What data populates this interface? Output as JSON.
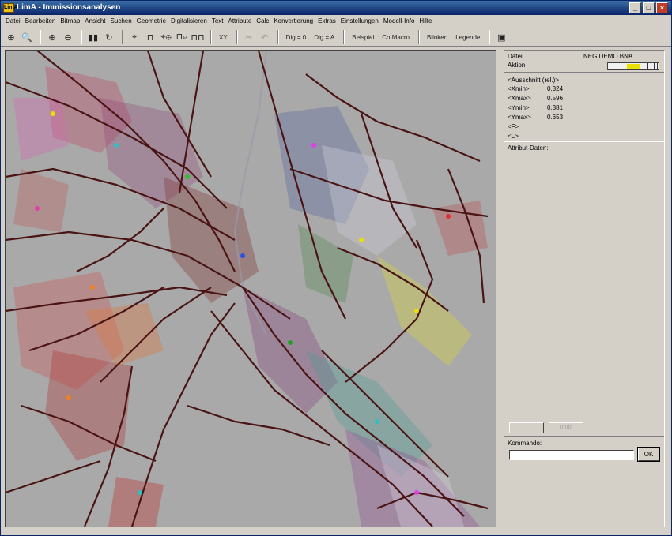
{
  "window": {
    "title": "LimA - Immissionsanalysen",
    "app_icon": "LimA",
    "buttons": [
      "_",
      "□",
      "×"
    ]
  },
  "menu": [
    "Datei",
    "Bearbeiten",
    "Bitmap",
    "Ansicht",
    "Suchen",
    "Geometrie",
    "Digitalisieren",
    "Text",
    "Attribute",
    "Calc",
    "Konvertierung",
    "Extras",
    "Einstellungen",
    "Modell-Info",
    "Hilfe"
  ],
  "toolbar": {
    "zoom_in_icon": "magnifier-icon",
    "dig0": "Dig = 0",
    "digA": "Dig = A",
    "beispiel": "Beispiel",
    "comacro": "Co Macro",
    "blinken": "Blinken",
    "legende": "Legende",
    "xy": "XY"
  },
  "panel": {
    "datei_label": "Datei",
    "datei_value": "NEG  DEMO.BNA",
    "aktion_label": "Aktion",
    "ausschnitt_label": "<Ausschnitt (rel.)>",
    "coords": [
      {
        "label": "<Xmin>",
        "value": "0.324"
      },
      {
        "label": "<Xmax>",
        "value": "0.596"
      },
      {
        "label": "<Ymin>",
        "value": "0.381"
      },
      {
        "label": "<Ymax>",
        "value": "0.653"
      }
    ],
    "f_label": "<F>",
    "l_label": "<L>",
    "attribut_label": "Attribut-Daten:",
    "undo_label": "Undo",
    "kommando_label": "Kommando:",
    "ok_label": "OK"
  },
  "colors": {
    "map_background": "#a9a9a9",
    "road": "#4a1414",
    "title_bar": "#0a246a"
  }
}
